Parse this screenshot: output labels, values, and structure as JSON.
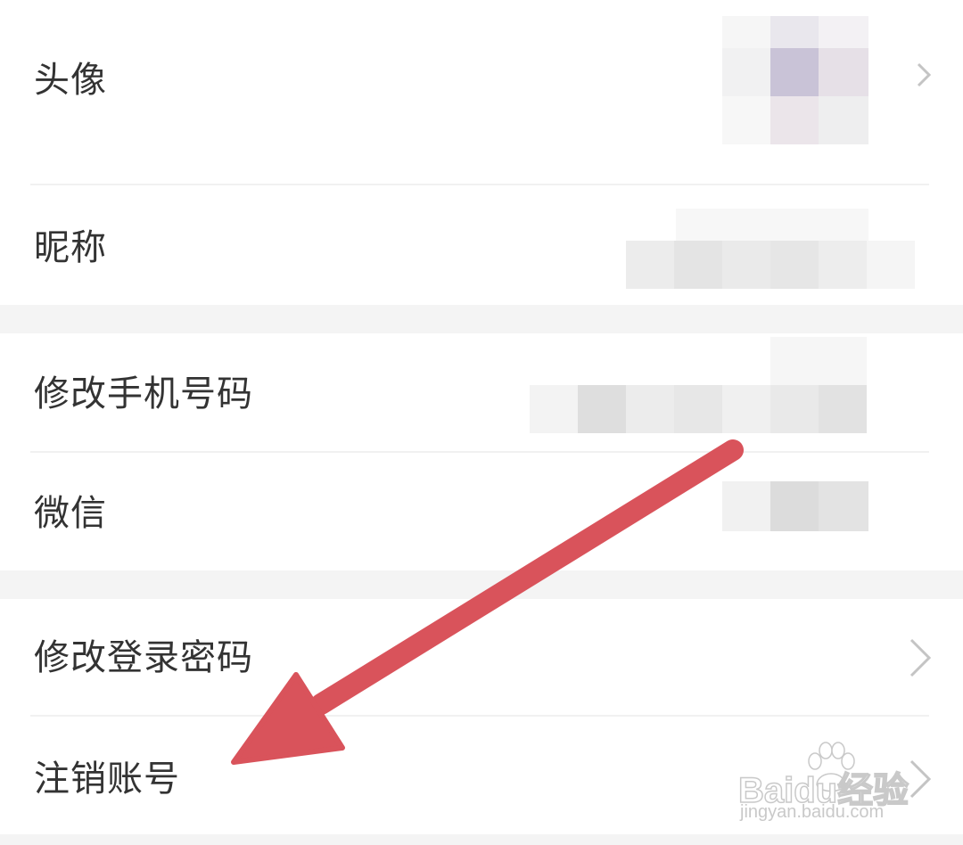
{
  "settings": {
    "rows": [
      {
        "label": "头像"
      },
      {
        "label": "昵称"
      },
      {
        "label": "修改手机号码"
      },
      {
        "label": "微信"
      },
      {
        "label": "修改登录密码"
      },
      {
        "label": "注销账号"
      }
    ]
  },
  "watermark": {
    "brand": "Baidu经验",
    "url": "jingyan.baidu.com"
  },
  "annotation": {
    "arrow_color": "#d9535b"
  },
  "colors": {
    "background": "#ffffff",
    "section_gap": "#f4f4f4",
    "text": "#333333",
    "chevron": "#c4c4c4"
  },
  "icons": [
    "chevron-right-icon",
    "baidu-paw-icon"
  ]
}
